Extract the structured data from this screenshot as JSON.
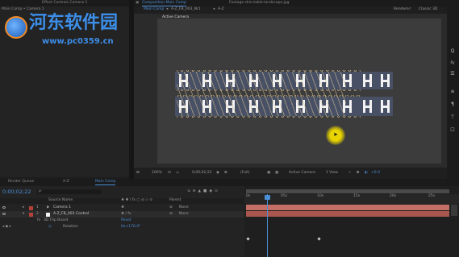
{
  "watermark": {
    "site_name": "河东软件园",
    "url": "www.pc0359.cn"
  },
  "top_left": {
    "tab_effect_controls": "Effect Controls Camera 1",
    "breadcrumb": "Main Comp • Camera 1"
  },
  "composition_panel": {
    "tab_label": "Composition Main Comp",
    "footage_tab": "Footage skin-table-landscape.jpg",
    "flow": [
      "Main Comp",
      "A-Z_FB_003_Nr1",
      "A-Z"
    ],
    "renderer_label": "Renderer:",
    "renderer_value": "Classic 3D",
    "active_camera_overlay": "Active Camera",
    "toolbar": {
      "zoom": "100%",
      "timecode": "0;00;02;22",
      "resolution": "(Full)",
      "view": "Active Camera",
      "views": "1 View",
      "exposure": "+0.0"
    }
  },
  "right_tools": [
    "Q",
    "Ry",
    "☰",
    "≡",
    "¶",
    "⊤",
    "☐"
  ],
  "timeline": {
    "tabs": [
      "Render Queue",
      "A-Z",
      "Main Comp"
    ],
    "active_tab": "Main Comp",
    "timecode": "0;00;02;22",
    "search_placeholder": "ρ·",
    "columns": {
      "source_name": "Source Name",
      "parent": "Parent"
    },
    "layers": [
      {
        "num": "1",
        "name": "Camera 1",
        "color": "#b5423a",
        "parent": "None"
      },
      {
        "num": "2",
        "name": "A-Z_FB_003 Control",
        "color": "#f2f2f2",
        "parent": "None"
      }
    ],
    "group_label": "3D Flip Board",
    "group_value": "Reset",
    "property_label": "Rotation",
    "property_value": "0x+176.0°",
    "ruler_labels": [
      "0s",
      "05s",
      "10s",
      "15s",
      "20s",
      "25s"
    ]
  }
}
